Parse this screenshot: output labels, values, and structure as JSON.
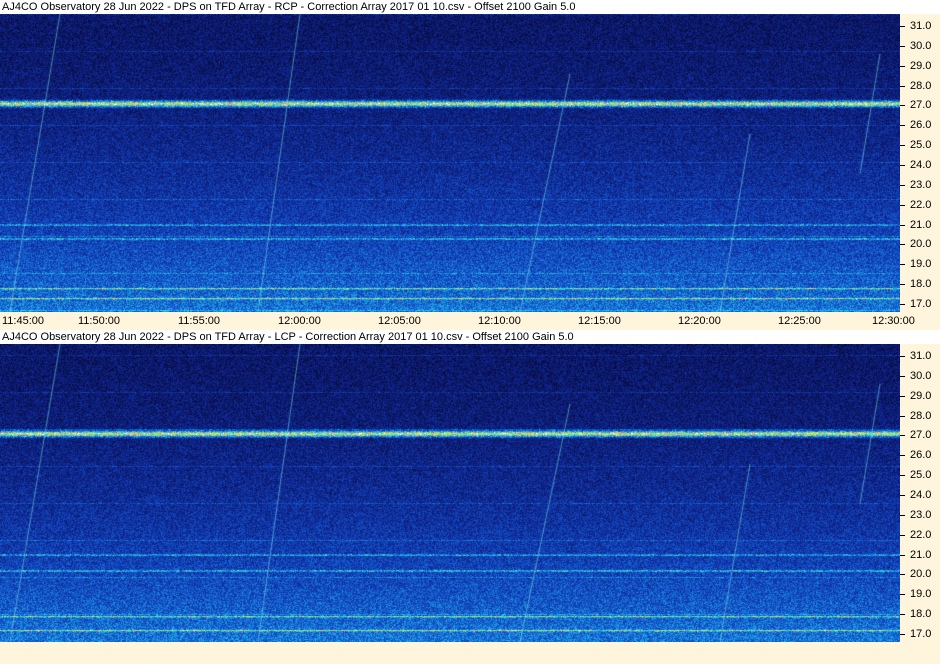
{
  "chart_data": [
    {
      "type": "heatmap",
      "title": "AJ4CO Observatory 28  Jun 2022  -  DPS on TFD Array  -  RCP  -  Correction Array 2017 01 10.csv  -  Offset 2100  Gain 5.0",
      "x_ticks": [
        "11:45:00",
        "11:50:00",
        "11:55:00",
        "12:00:00",
        "12:05:00",
        "12:10:00",
        "12:15:00",
        "12:20:00",
        "12:25:00",
        "12:30:00"
      ],
      "y_ticks": [
        "31.0",
        "30.0",
        "29.0",
        "28.0",
        "27.0",
        "26.0",
        "25.0",
        "24.0",
        "23.0",
        "22.0",
        "21.0",
        "20.0",
        "19.0",
        "18.0",
        "17.0"
      ],
      "ylim": [
        16.6,
        31.6
      ],
      "unit_hint": "MHz",
      "bright_bands_mhz": [
        27.1,
        17.8,
        17.3,
        21.0,
        20.3
      ],
      "colormap": "dark blue to cyan to yellow to white"
    },
    {
      "type": "heatmap",
      "title": "AJ4CO Observatory 28  Jun 2022  -  DPS on TFD Array  -  LCP  -  Correction Array 2017 01 10.csv  -  Offset 2100  Gain 5.0",
      "x_ticks": [],
      "y_ticks": [
        "31.0",
        "30.0",
        "29.0",
        "28.0",
        "27.0",
        "26.0",
        "25.0",
        "24.0",
        "23.0",
        "22.0",
        "21.0",
        "20.0",
        "19.0",
        "18.0",
        "17.0"
      ],
      "ylim": [
        16.6,
        31.6
      ],
      "bright_bands_mhz": [
        27.1,
        17.9,
        17.2,
        21.0,
        20.2
      ],
      "colormap": "dark blue to cyan to yellow to white"
    }
  ]
}
